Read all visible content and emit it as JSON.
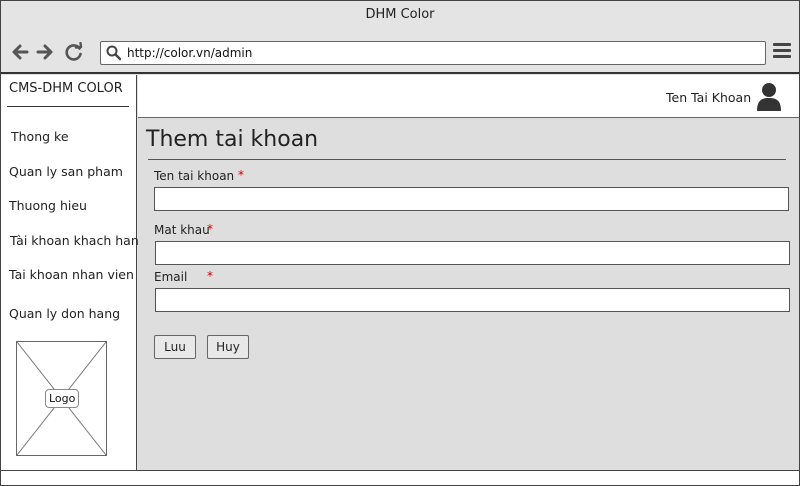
{
  "window": {
    "title": "DHM Color"
  },
  "browser": {
    "url": "http://color.vn/admin"
  },
  "sidebar": {
    "brand": "CMS-DHM COLOR",
    "items": [
      {
        "label": "Thong ke"
      },
      {
        "label": "Quan ly san pham"
      },
      {
        "label": "Thuong hieu"
      },
      {
        "label": "Tài khoan khach hang"
      },
      {
        "label": "Tai khoan nhan vien"
      },
      {
        "label": "Quan ly don hang"
      }
    ],
    "logo_label": "Logo"
  },
  "header": {
    "account_name": "Ten Tai Khoan"
  },
  "main": {
    "title": "Them tai khoan",
    "form": {
      "username": {
        "label": "Ten tai khoan",
        "required_mark": "*",
        "value": ""
      },
      "password": {
        "label": "Mat khau",
        "required_mark": "*",
        "value": ""
      },
      "email": {
        "label": "Email",
        "required_mark": "*",
        "value": ""
      }
    },
    "buttons": {
      "save": "Luu",
      "cancel": "Huy"
    }
  },
  "colors": {
    "required": "#cc0000",
    "page_bg": "#dedede"
  }
}
